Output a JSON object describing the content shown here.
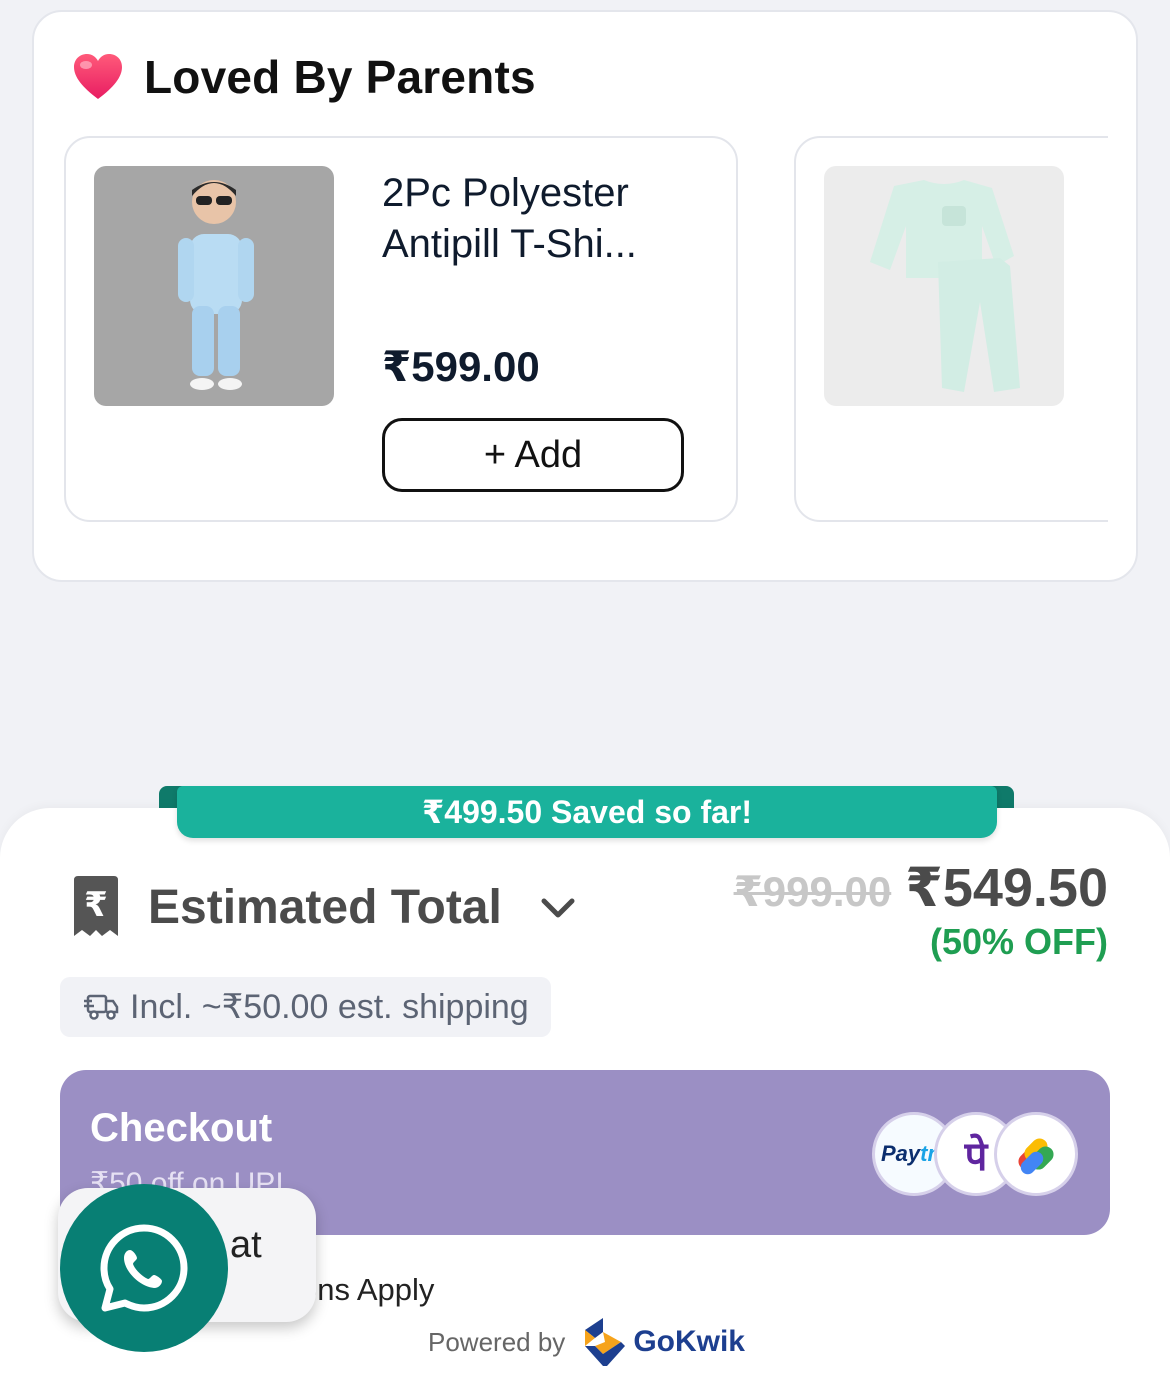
{
  "loved": {
    "title": "Loved By Parents",
    "icon": "heart-icon",
    "products": [
      {
        "name": "2Pc Polyester Antipill T-Shi...",
        "price": "₹599.00",
        "add_label": "+ Add"
      },
      {
        "name": "",
        "price": "",
        "add_label": ""
      }
    ]
  },
  "summary": {
    "saved_banner": "₹499.50 Saved so far!",
    "estimated_label": "Estimated Total",
    "mrp": "₹999.00",
    "final_price": "₹549.50",
    "discount": "(50% OFF)",
    "shipping_note": "Incl. ~₹50.00 est. shipping",
    "checkout_title": "Checkout",
    "checkout_sub": "₹50 off on UPI",
    "payment_icons": [
      "paytm-icon",
      "phonepe-icon",
      "google-pay-icon"
    ],
    "paytm_label_a": "Pay",
    "paytm_label_b": "tm",
    "phonepe_glyph": "पे",
    "terms": "ons Apply",
    "powered_by": "Powered by",
    "brand": "GoKwik"
  },
  "chat": {
    "label": "at",
    "icon": "whatsapp-icon"
  },
  "colors": {
    "accent_green": "#1ab29c",
    "checkout_purple": "#9b8fc4",
    "discount_green": "#1f9e52",
    "whatsapp_teal": "#087f74"
  }
}
